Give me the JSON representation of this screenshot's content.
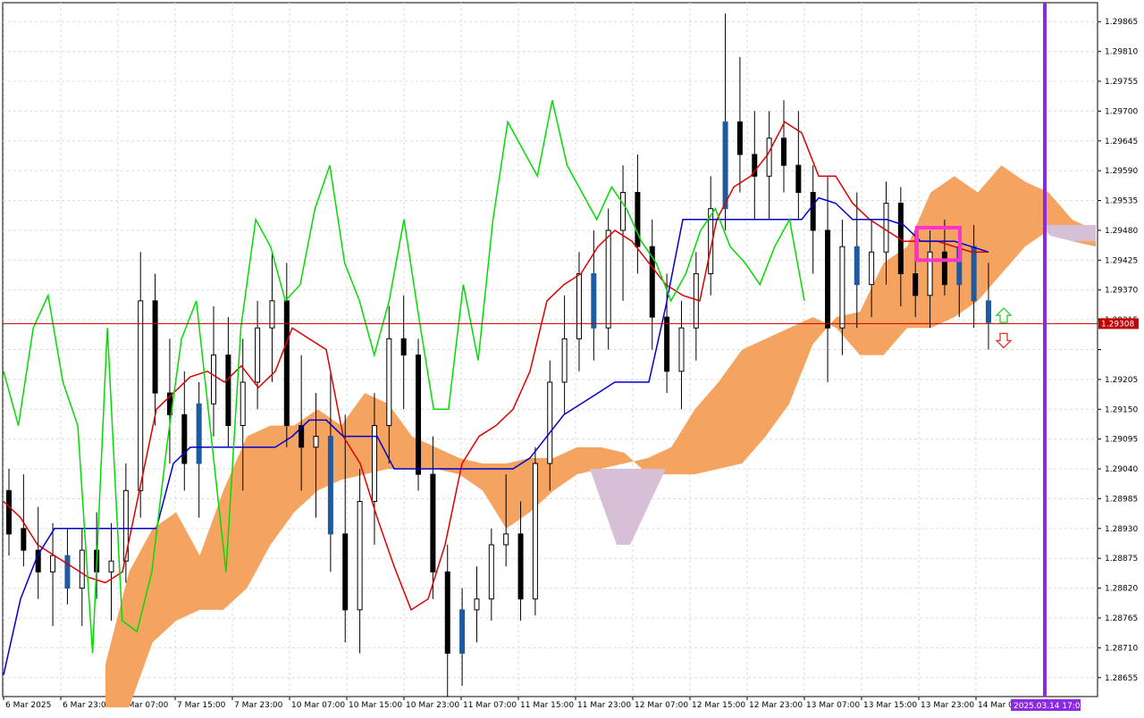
{
  "chart_data": {
    "type": "candlestick",
    "ylim": [
      1.2862,
      1.299
    ],
    "y_ticks": [
      1.29865,
      1.2981,
      1.29755,
      1.297,
      1.29645,
      1.2959,
      1.29535,
      1.2948,
      1.29425,
      1.2937,
      1.29315,
      1.2926,
      1.29205,
      1.2915,
      1.29095,
      1.2904,
      1.28985,
      1.2893,
      1.28875,
      1.2882,
      1.28765,
      1.2871,
      1.28655
    ],
    "y_tick_labels": [
      "1.29865",
      "1.29810",
      "1.29755",
      "1.29700",
      "1.29645",
      "1.29590",
      "1.29535",
      "1.29480",
      "1.29425",
      "1.29370",
      "1.29315",
      "",
      "1.29205",
      "1.29150",
      "1.29095",
      "1.29040",
      "1.28985",
      "1.28930",
      "1.28875",
      "1.28820",
      "1.28765",
      "1.28710",
      "1.28655"
    ],
    "x_labels": [
      "6 Mar 2025",
      "6 Mar 23:00",
      "7 Mar 07:00",
      "7 Mar 15:00",
      "7 Mar 23:00",
      "10 Mar 07:00",
      "10 Mar 15:00",
      "10 Mar 23:00",
      "11 Mar 07:00",
      "11 Mar 15:00",
      "11 Mar 23:00",
      "12 Mar 07:00",
      "12 Mar 15:00",
      "12 Mar 23:00",
      "13 Mar 07:00",
      "13 Mar 15:00",
      "13 Mar 23:00",
      "14 Mar 07"
    ],
    "current_price": 1.29308,
    "current_price_label": "1.29308",
    "time_marker_label": "2025.03.14 17:00",
    "candles": [
      [
        1.29,
        1.2904,
        1.2888,
        1.2892
      ],
      [
        1.2893,
        1.2903,
        1.2886,
        1.2889
      ],
      [
        1.2889,
        1.2897,
        1.288,
        1.2885
      ],
      [
        1.2885,
        1.2894,
        1.2875,
        1.2888
      ],
      [
        1.2888,
        1.2893,
        1.2879,
        1.2882
      ],
      [
        1.2882,
        1.2893,
        1.2875,
        1.2889
      ],
      [
        1.2889,
        1.2896,
        1.288,
        1.2885
      ],
      [
        1.2885,
        1.2894,
        1.2876,
        1.2887
      ],
      [
        1.2887,
        1.2905,
        1.2883,
        1.29
      ],
      [
        1.29,
        1.2944,
        1.2895,
        1.2935
      ],
      [
        1.2935,
        1.294,
        1.2912,
        1.2918
      ],
      [
        1.2918,
        1.2928,
        1.2905,
        1.2914
      ],
      [
        1.2914,
        1.2922,
        1.29,
        1.2905
      ],
      [
        1.2905,
        1.292,
        1.2895,
        1.2916
      ],
      [
        1.2916,
        1.2934,
        1.291,
        1.2925
      ],
      [
        1.2925,
        1.2932,
        1.2908,
        1.2912
      ],
      [
        1.2912,
        1.2928,
        1.29,
        1.292
      ],
      [
        1.292,
        1.2935,
        1.2915,
        1.293
      ],
      [
        1.293,
        1.2944,
        1.292,
        1.2935
      ],
      [
        1.2935,
        1.2942,
        1.2908,
        1.2912
      ],
      [
        1.2912,
        1.2925,
        1.29,
        1.2908
      ],
      [
        1.2908,
        1.2918,
        1.2895,
        1.291
      ],
      [
        1.291,
        1.2922,
        1.2885,
        1.2892
      ],
      [
        1.2892,
        1.2914,
        1.2872,
        1.2878
      ],
      [
        1.2878,
        1.2904,
        1.287,
        1.2898
      ],
      [
        1.2898,
        1.2918,
        1.289,
        1.2912
      ],
      [
        1.2912,
        1.2934,
        1.2905,
        1.2928
      ],
      [
        1.2928,
        1.2936,
        1.2915,
        1.2925
      ],
      [
        1.2925,
        1.2928,
        1.29,
        1.2903
      ],
      [
        1.2903,
        1.291,
        1.288,
        1.2885
      ],
      [
        1.2885,
        1.289,
        1.2862,
        1.287
      ],
      [
        1.287,
        1.2882,
        1.2864,
        1.2878
      ],
      [
        1.2878,
        1.2886,
        1.2872,
        1.288
      ],
      [
        1.288,
        1.2893,
        1.2876,
        1.289
      ],
      [
        1.289,
        1.2903,
        1.2886,
        1.2892
      ],
      [
        1.2892,
        1.2898,
        1.2876,
        1.288
      ],
      [
        1.288,
        1.2908,
        1.2877,
        1.2905
      ],
      [
        1.2905,
        1.2924,
        1.29,
        1.292
      ],
      [
        1.292,
        1.2936,
        1.2914,
        1.2928
      ],
      [
        1.2928,
        1.2944,
        1.2922,
        1.294
      ],
      [
        1.294,
        1.2948,
        1.2924,
        1.293
      ],
      [
        1.293,
        1.2952,
        1.2926,
        1.2948
      ],
      [
        1.2948,
        1.296,
        1.2935,
        1.2955
      ],
      [
        1.2955,
        1.2962,
        1.294,
        1.2945
      ],
      [
        1.2945,
        1.295,
        1.2926,
        1.2932
      ],
      [
        1.2932,
        1.294,
        1.2918,
        1.2922
      ],
      [
        1.2922,
        1.2935,
        1.2915,
        1.293
      ],
      [
        1.293,
        1.2944,
        1.2924,
        1.294
      ],
      [
        1.294,
        1.2958,
        1.2936,
        1.2952
      ],
      [
        1.2952,
        1.2988,
        1.2948,
        1.2968
      ],
      [
        1.2968,
        1.298,
        1.2955,
        1.2962
      ],
      [
        1.2962,
        1.297,
        1.295,
        1.2958
      ],
      [
        1.2958,
        1.297,
        1.295,
        1.2965
      ],
      [
        1.2965,
        1.2972,
        1.2955,
        1.296
      ],
      [
        1.296,
        1.297,
        1.295,
        1.2955
      ],
      [
        1.2955,
        1.296,
        1.294,
        1.2948
      ],
      [
        1.2948,
        1.2958,
        1.292,
        1.293
      ],
      [
        1.293,
        1.295,
        1.2925,
        1.2945
      ],
      [
        1.2945,
        1.2955,
        1.293,
        1.2938
      ],
      [
        1.2938,
        1.295,
        1.2932,
        1.2944
      ],
      [
        1.2944,
        1.2957,
        1.2938,
        1.2953
      ],
      [
        1.2953,
        1.2956,
        1.2934,
        1.294
      ],
      [
        1.294,
        1.2948,
        1.2932,
        1.2936
      ],
      [
        1.2936,
        1.2948,
        1.293,
        1.2944
      ],
      [
        1.2944,
        1.295,
        1.2936,
        1.2938
      ],
      [
        1.2938,
        1.2948,
        1.2932,
        1.2945
      ],
      [
        1.2945,
        1.2949,
        1.293,
        1.2935
      ],
      [
        1.2935,
        1.2942,
        1.2926,
        1.2931
      ]
    ],
    "series": [
      {
        "name": "",
        "color": "#dd0000",
        "values": [
          1.2898,
          1.2895,
          1.289,
          1.2888,
          1.2886,
          1.2884,
          1.2883,
          1.2885,
          1.29,
          1.2915,
          1.2918,
          1.2921,
          1.2922,
          1.292,
          1.2923,
          1.2919,
          1.2922,
          1.293,
          1.2928,
          1.2926,
          1.291,
          1.2905,
          1.2895,
          1.2886,
          1.2878,
          1.288,
          1.289,
          1.2905,
          1.291,
          1.2912,
          1.2915,
          1.2922,
          1.2935,
          1.2938,
          1.294,
          1.2945,
          1.2948,
          1.2946,
          1.2942,
          1.2938,
          1.2936,
          1.2935,
          1.295,
          1.2956,
          1.2958,
          1.2962,
          1.2968,
          1.2966,
          1.2958,
          1.2958,
          1.2953,
          1.295,
          1.2948,
          1.2946,
          1.2946,
          1.2946,
          1.2945,
          1.2944,
          1.2944
        ]
      },
      {
        "name": "",
        "color": "#0000cc",
        "values": [
          1.2866,
          1.288,
          1.2888,
          1.2893,
          1.2893,
          1.2893,
          1.2893,
          1.2893,
          1.2893,
          1.2893,
          1.2905,
          1.2908,
          1.2908,
          1.2908,
          1.2908,
          1.2908,
          1.2908,
          1.291,
          1.2913,
          1.2913,
          1.291,
          1.291,
          1.291,
          1.2904,
          1.2904,
          1.2904,
          1.2904,
          1.2904,
          1.2904,
          1.2904,
          1.2904,
          1.2906,
          1.291,
          1.2914,
          1.2916,
          1.2918,
          1.292,
          1.292,
          1.292,
          1.2934,
          1.295,
          1.295,
          1.295,
          1.295,
          1.295,
          1.295,
          1.295,
          1.295,
          1.2954,
          1.2953,
          1.295,
          1.295,
          1.295,
          1.2949,
          1.2946,
          1.2946,
          1.2946,
          1.2945,
          1.2944
        ]
      },
      {
        "name": "",
        "color": "#00dd00",
        "values": [
          1.2922,
          1.2912,
          1.293,
          1.2936,
          1.292,
          1.2912,
          1.287,
          1.293,
          1.2876,
          1.2874,
          1.2885,
          1.2908,
          1.2928,
          1.2935,
          1.291,
          1.2885,
          1.293,
          1.295,
          1.2945,
          1.2935,
          1.2938,
          1.2952,
          1.296,
          1.2942,
          1.2935,
          1.2925,
          1.2935,
          1.295,
          1.2932,
          1.2915,
          1.2915,
          1.2938,
          1.2924,
          1.295,
          1.2968,
          1.2963,
          1.2958,
          1.2972,
          1.296,
          1.2955,
          1.295,
          1.2956,
          1.2952,
          1.2946,
          1.2942,
          1.2935,
          1.294,
          1.2948,
          1.2952,
          1.2945,
          1.2942,
          1.2938,
          1.2945,
          1.295,
          1.2935
        ]
      }
    ],
    "cloud": {
      "top": [
        1.2868,
        1.2885,
        1.2893,
        1.2896,
        1.2888,
        1.29,
        1.291,
        1.2912,
        1.2912,
        1.2915,
        1.2912,
        1.2918,
        1.2916,
        1.291,
        1.2908,
        1.2906,
        1.2905,
        1.2905,
        1.2906,
        1.2906,
        1.2908,
        1.2908,
        1.2907,
        1.2903,
        1.2903,
        1.2903,
        1.2904,
        1.2905,
        1.291,
        1.2916,
        1.2927,
        1.2932,
        1.2933,
        1.2942,
        1.2945,
        1.2955,
        1.2958,
        1.2955,
        1.296,
        1.2957,
        1.2955,
        1.295,
        1.2948
      ],
      "bottom": [
        1.286,
        1.286,
        1.2872,
        1.2876,
        1.2878,
        1.2878,
        1.2882,
        1.289,
        1.2896,
        1.29,
        1.2902,
        1.2903,
        1.2904,
        1.2904,
        1.2904,
        1.2903,
        1.29,
        1.2893,
        1.2896,
        1.29,
        1.2903,
        1.2904,
        1.2905,
        1.2906,
        1.2908,
        1.2915,
        1.292,
        1.2926,
        1.2928,
        1.293,
        1.2932,
        1.293,
        1.2925,
        1.2925,
        1.293,
        1.293,
        1.2932,
        1.2935,
        1.294,
        1.2945,
        1.2948,
        1.2946,
        1.2945
      ],
      "bear_color": "#f4a460",
      "bull_color": "#d8bfd8"
    },
    "colors": {
      "bull_candle": "#ffffff",
      "bear_candle": "#000000",
      "highlight_candle": "#1e5aa0",
      "time_marker": "#8a2be2",
      "price_line": "#c00000",
      "highlight_box": "#ff33cc",
      "arrow_up": "#33cc33",
      "arrow_down": "#e03030"
    },
    "title": "",
    "xlabel": "",
    "ylabel": "",
    "grid": true
  }
}
